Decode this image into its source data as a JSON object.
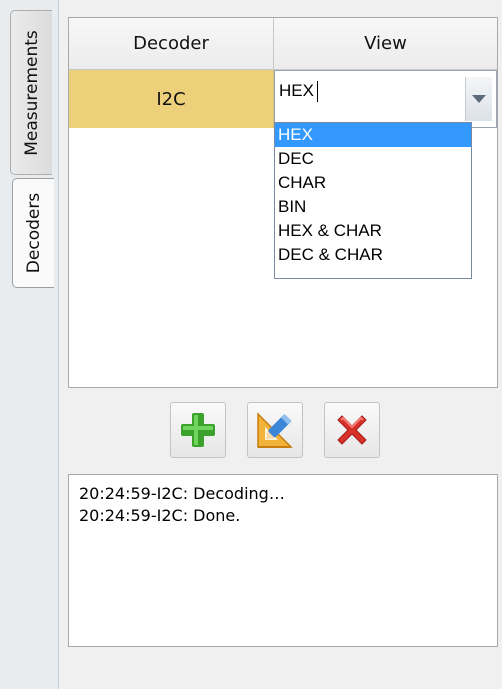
{
  "tabs": {
    "measurements": "Measurements",
    "decoders": "Decoders"
  },
  "table": {
    "headers": {
      "decoder": "Decoder",
      "view": "View"
    },
    "rows": [
      {
        "decoder": "I2C",
        "view": "HEX"
      }
    ]
  },
  "view_dropdown": {
    "options": [
      "HEX",
      "DEC",
      "CHAR",
      "BIN",
      "HEX & CHAR",
      "DEC & CHAR"
    ],
    "selected": "HEX"
  },
  "toolbar": {
    "add_icon": "plus-icon",
    "edit_icon": "edit-icon",
    "delete_icon": "delete-icon",
    "colors": {
      "add": "#3aa12b",
      "delete": "#d9302a",
      "edit": "#e8961a"
    }
  },
  "log": {
    "lines": [
      "20:24:59-I2C: Decoding…",
      "20:24:59-I2C: Done."
    ]
  }
}
